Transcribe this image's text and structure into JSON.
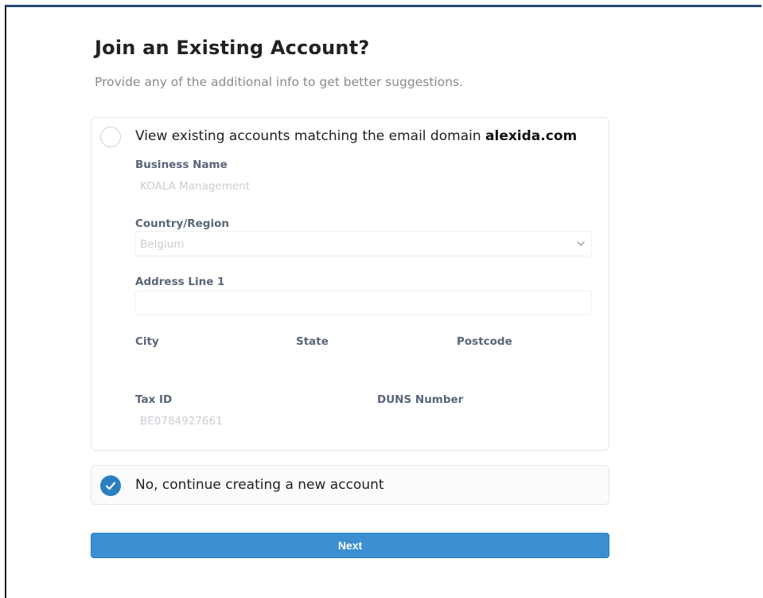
{
  "page": {
    "title": "Join an Existing Account?",
    "subtitle": "Provide any of the additional info to get better suggestions."
  },
  "option_existing": {
    "label_prefix": "View existing accounts matching the email domain ",
    "domain": "alexida.com",
    "selected": false
  },
  "form": {
    "business_name": {
      "label": "Business Name",
      "value": "KOALA Management"
    },
    "country": {
      "label": "Country/Region",
      "value": "Belgium",
      "icon": "chevron-down-icon"
    },
    "address_line1": {
      "label": "Address Line 1",
      "value": ""
    },
    "city": {
      "label": "City",
      "value": ""
    },
    "state": {
      "label": "State",
      "value": ""
    },
    "postcode": {
      "label": "Postcode",
      "value": ""
    },
    "tax_id": {
      "label": "Tax ID",
      "value": "BE0784927661"
    },
    "duns": {
      "label": "DUNS Number",
      "value": ""
    }
  },
  "option_new": {
    "label": "No, continue creating a new account",
    "selected": true,
    "icon": "check-icon"
  },
  "next_button": {
    "label": "Next"
  },
  "colors": {
    "accent": "#3b8fd0",
    "checked_radio": "#2a7fc1",
    "label": "#596579",
    "placeholder": "#c9cdd2"
  }
}
